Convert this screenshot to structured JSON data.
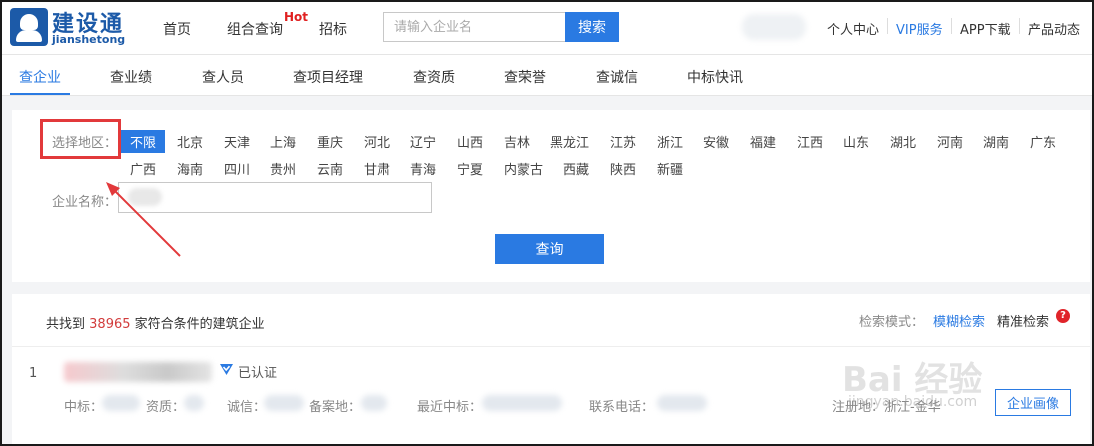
{
  "header": {
    "logo_cn": "建设通",
    "logo_en": "jianshetong",
    "nav": [
      "首页",
      "组合查询",
      "招标"
    ],
    "hot_badge": "Hot",
    "search_placeholder": "请输入企业名",
    "search_button": "搜索",
    "links": [
      "个人中心",
      "VIP服务",
      "APP下载",
      "产品动态"
    ]
  },
  "tabs": [
    "查企业",
    "查业绩",
    "查人员",
    "查项目经理",
    "查资质",
    "查荣誉",
    "查诚信",
    "中标快讯"
  ],
  "filter": {
    "region_label": "选择地区：",
    "regions": [
      "不限",
      "北京",
      "天津",
      "上海",
      "重庆",
      "河北",
      "辽宁",
      "山西",
      "吉林",
      "黑龙江",
      "江苏",
      "浙江",
      "安徽",
      "福建",
      "江西",
      "山东",
      "湖北",
      "河南",
      "湖南",
      "广东",
      "广西",
      "海南",
      "四川",
      "贵州",
      "云南",
      "甘肃",
      "青海",
      "宁夏",
      "内蒙古",
      "西藏",
      "陕西",
      "新疆"
    ],
    "selected_region": "不限",
    "name_label": "企业名称：",
    "query_button": "查询"
  },
  "results": {
    "count_prefix": "共找到",
    "count": "38965",
    "count_suffix": "家符合条件的建筑企业",
    "mode_label": "检索模式：",
    "mode_fuzzy": "模糊检索",
    "mode_exact": "精准检索",
    "help_icon": "?",
    "row_index": "1",
    "verified": "已认证",
    "fields": [
      "中标：",
      "资质：",
      "诚信：",
      "备案地：",
      "最近中标：",
      "联系电话："
    ],
    "reg_location": "注册地：浙江-金华",
    "portrait_button": "企业画像"
  },
  "watermark": {
    "main": "Bai 经验",
    "sub": "jingyan.baidu.com"
  },
  "colors": {
    "accent": "#2a7ae2",
    "hot": "#e02020",
    "annotation": "#e2393b"
  }
}
